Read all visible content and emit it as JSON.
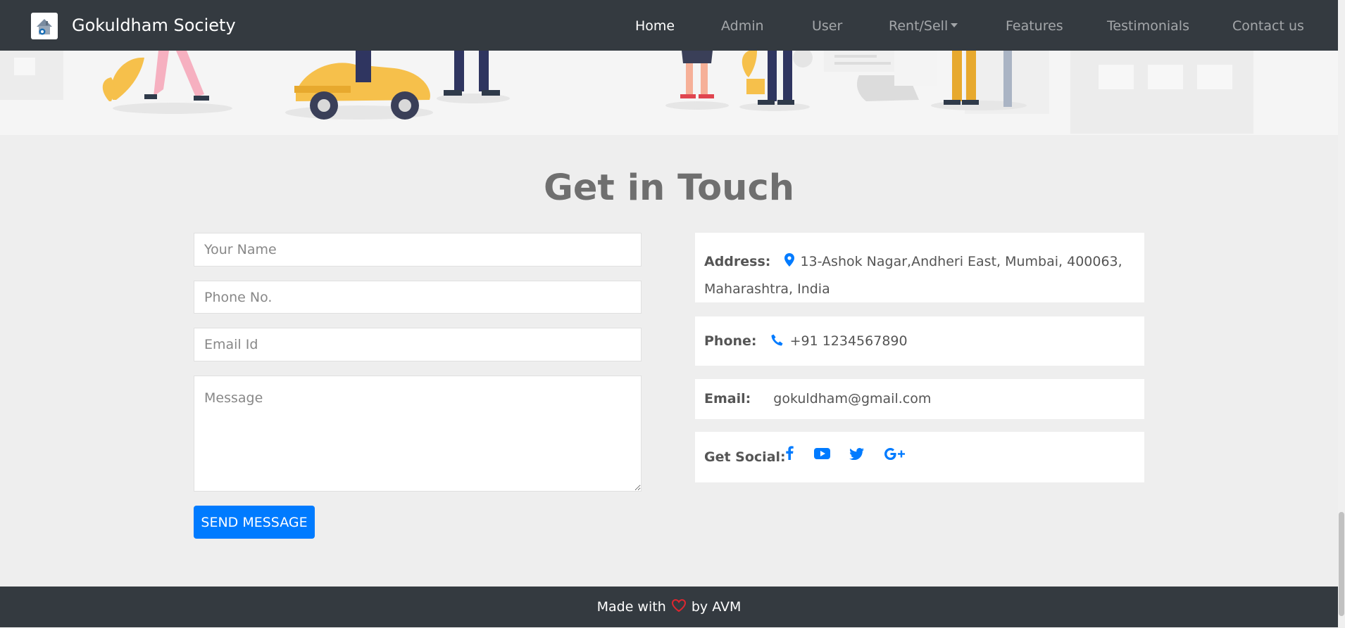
{
  "navbar": {
    "brand": "Gokuldham Society",
    "items": [
      {
        "label": "Home",
        "active": true
      },
      {
        "label": "Admin"
      },
      {
        "label": "User"
      },
      {
        "label": "Rent/Sell",
        "dropdown": true
      },
      {
        "label": "Features"
      },
      {
        "label": "Testimonials"
      },
      {
        "label": "Contact us"
      }
    ],
    "bg_color": "#343a40"
  },
  "contact": {
    "title": "Get in Touch",
    "form": {
      "name_placeholder": "Your Name",
      "phone_placeholder": "Phone No.",
      "email_placeholder": "Email Id",
      "message_placeholder": "Message",
      "send_label": "SEND MESSAGE"
    },
    "info": {
      "address_label": "Address:",
      "address_line1": "13-Ashok Nagar,Andheri East, Mumbai, 400063,",
      "address_line2": "Maharashtra, India",
      "phone_label": "Phone:",
      "phone_value": "+91 1234567890",
      "email_label": "Email:",
      "email_value": "gokuldham@gmail.com",
      "social_label": "Get Social:",
      "social_icons": [
        "facebook-icon",
        "youtube-icon",
        "twitter-icon",
        "google-plus-icon"
      ]
    },
    "accent_color": "#007bff"
  },
  "footer": {
    "made_with": "Made with",
    "by": "by AVM",
    "heart_color": "#e0262f"
  }
}
